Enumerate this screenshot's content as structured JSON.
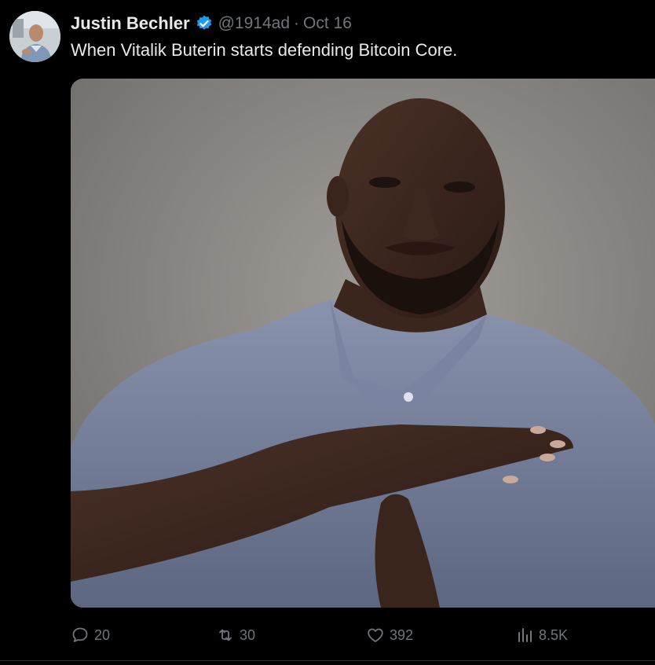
{
  "author": {
    "name": "Justin Bechler",
    "handle": "@1914ad",
    "separator": "·",
    "date": "Oct 16",
    "verified": true,
    "avatar_icon": "profile-photo"
  },
  "post": {
    "text": "When Vitalik Buterin starts defending Bitcoin Core.",
    "media_description_icon": "man-making-timeout-gesture-photo"
  },
  "actions": {
    "reply_count": "20",
    "repost_count": "30",
    "like_count": "392",
    "views_count": "8.5K"
  },
  "colors": {
    "background": "#000000",
    "primary_text": "#e7e9ea",
    "secondary_text": "#71767b",
    "verified_blue": "#1d9bf0",
    "divider": "#2f3336"
  }
}
